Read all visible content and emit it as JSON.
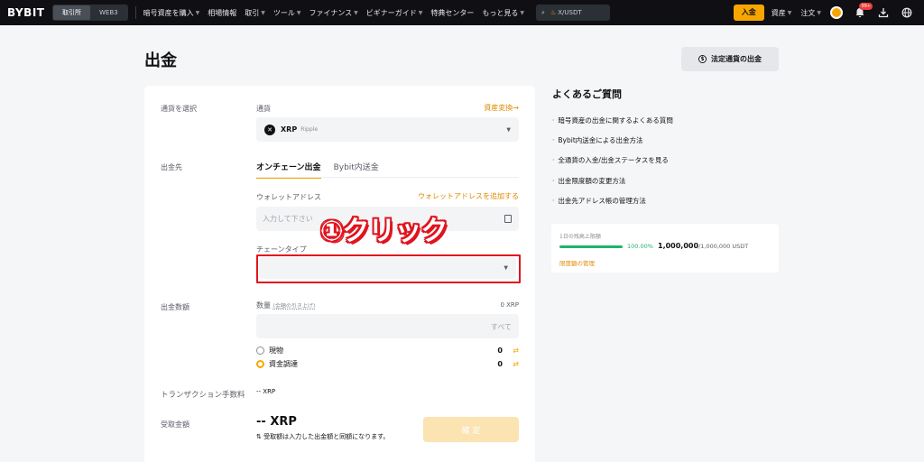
{
  "nav": {
    "logo": "BYBIT",
    "segments": [
      "取引所",
      "WEB3"
    ],
    "menu": [
      "暗号資産を購入",
      "相場情報",
      "取引",
      "ツール",
      "ファイナンス",
      "ビギナーガイド",
      "特典センター",
      "もっと見る"
    ],
    "search_text": "X/USDT",
    "deposit": "入金",
    "assets": "資産",
    "orders": "注文",
    "badge": "99+"
  },
  "page": {
    "title": "出金",
    "fiat_button": "法定通貨の出金"
  },
  "form": {
    "select_coin_label": "通貨を選択",
    "coin_label": "通貨",
    "convert_link": "資産変換→",
    "coin_symbol": "XRP",
    "coin_name": "Ripple",
    "destination_label": "出金先",
    "tabs": [
      "オンチェーン出金",
      "Bybit内送金"
    ],
    "wallet_label": "ウォレットアドレス",
    "add_wallet_link": "ウォレットアドレスを追加する",
    "wallet_placeholder": "入力して下さい",
    "chain_label": "チェーンタイプ",
    "amount_section": "出金数額",
    "qty_label": "数量",
    "qty_hint": "(金額の引き上げ)",
    "qty_balance": "0 XRP",
    "all": "すべて",
    "radio": [
      {
        "label": "現物",
        "value": "0"
      },
      {
        "label": "資金調達",
        "value": "0"
      }
    ],
    "fee_label": "トランザクション手数料",
    "fee_value": "-- XRP",
    "receive_label": "受取金額",
    "receive_value": "-- XRP",
    "receive_note": "⇅ 受取額は入力した出金額と同額になります。",
    "confirm": "確 定"
  },
  "annotation": "①クリック",
  "faq": {
    "title": "よくあるご質問",
    "items": [
      "暗号資産の出金に関するよくある質問",
      "Bybit内送金による出金方法",
      "全通貨の入金/出金ステータスを見る",
      "出金限度額の変更方法",
      "出金先アドレス帳の管理方法"
    ]
  },
  "limit": {
    "title": "1日の残高上限額",
    "percent": "100.00%",
    "amount": "1,000,000",
    "total": "/1,000,000 USDT",
    "link": "限度額の管理"
  },
  "colors": {
    "accent": "#f7a600",
    "highlight": "#e0141e",
    "success": "#20b26c"
  }
}
